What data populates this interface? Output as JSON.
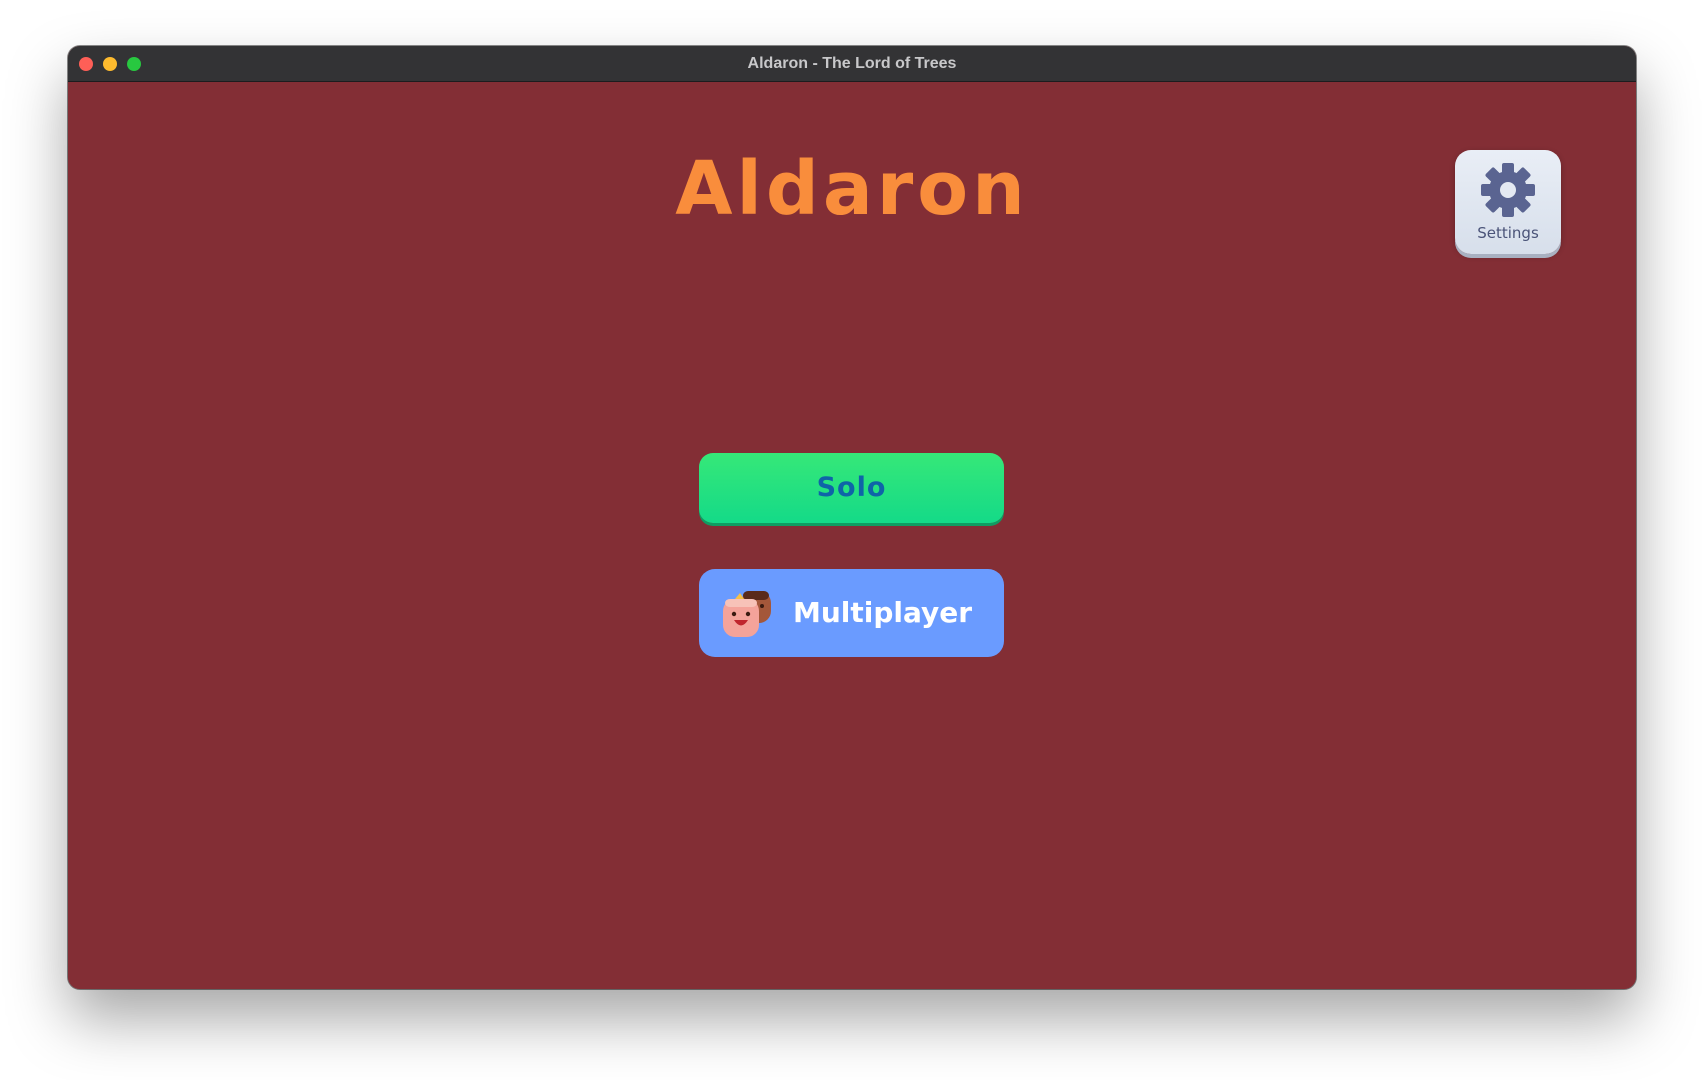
{
  "window": {
    "title": "Aldaron - The Lord of Trees"
  },
  "main": {
    "game_title": "Aldaron",
    "settings_label": "Settings",
    "solo_label": "Solo",
    "multiplayer_label": "Multiplayer"
  },
  "icons": {
    "settings": "gear-icon",
    "multiplayer": "players-icon"
  },
  "colors": {
    "background": "#832e35",
    "title": "#f98d3c",
    "solo_button": "#1ee07f",
    "solo_text": "#0f64a8",
    "multiplayer_button": "#6a9bff",
    "settings_button": "#e2e8f1",
    "settings_text": "#4a5378"
  }
}
